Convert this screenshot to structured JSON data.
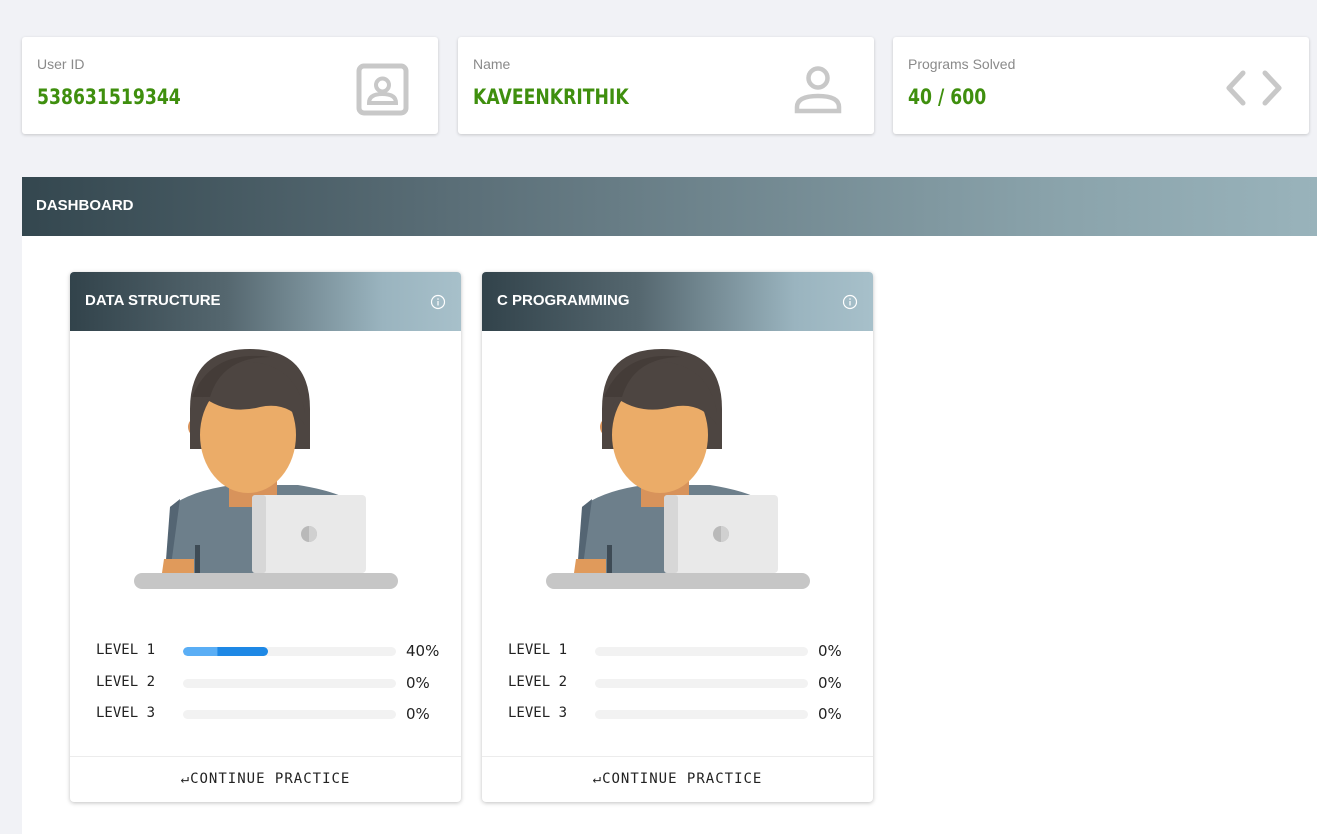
{
  "stats": [
    {
      "label": "User ID",
      "value": "538631519344",
      "icon": "contact-card-icon"
    },
    {
      "label": "Name",
      "value": "KAVEENKRITHIK",
      "icon": "user-icon"
    },
    {
      "label": "Programs Solved",
      "value": "40 / 600",
      "icon": "code-brackets-icon"
    }
  ],
  "dashboard": {
    "title": "DASHBOARD"
  },
  "courses": [
    {
      "title": "DATA STRUCTURE",
      "levels": [
        {
          "label": "LEVEL 1",
          "percent_text": "40%",
          "progress": 40
        },
        {
          "label": "LEVEL 2",
          "percent_text": "0%",
          "progress": 0
        },
        {
          "label": "LEVEL 3",
          "percent_text": "0%",
          "progress": 0
        }
      ],
      "action": "CONTINUE PRACTICE"
    },
    {
      "title": "C PROGRAMMING",
      "levels": [
        {
          "label": "LEVEL 1",
          "percent_text": "0%",
          "progress": 0
        },
        {
          "label": "LEVEL 2",
          "percent_text": "0%",
          "progress": 0
        },
        {
          "label": "LEVEL 3",
          "percent_text": "0%",
          "progress": 0
        }
      ],
      "action": "CONTINUE PRACTICE"
    }
  ],
  "colors": {
    "accent_green": "#3f8f0e",
    "progress_blue": "#1e88e5",
    "header_dark": "#34474f"
  }
}
